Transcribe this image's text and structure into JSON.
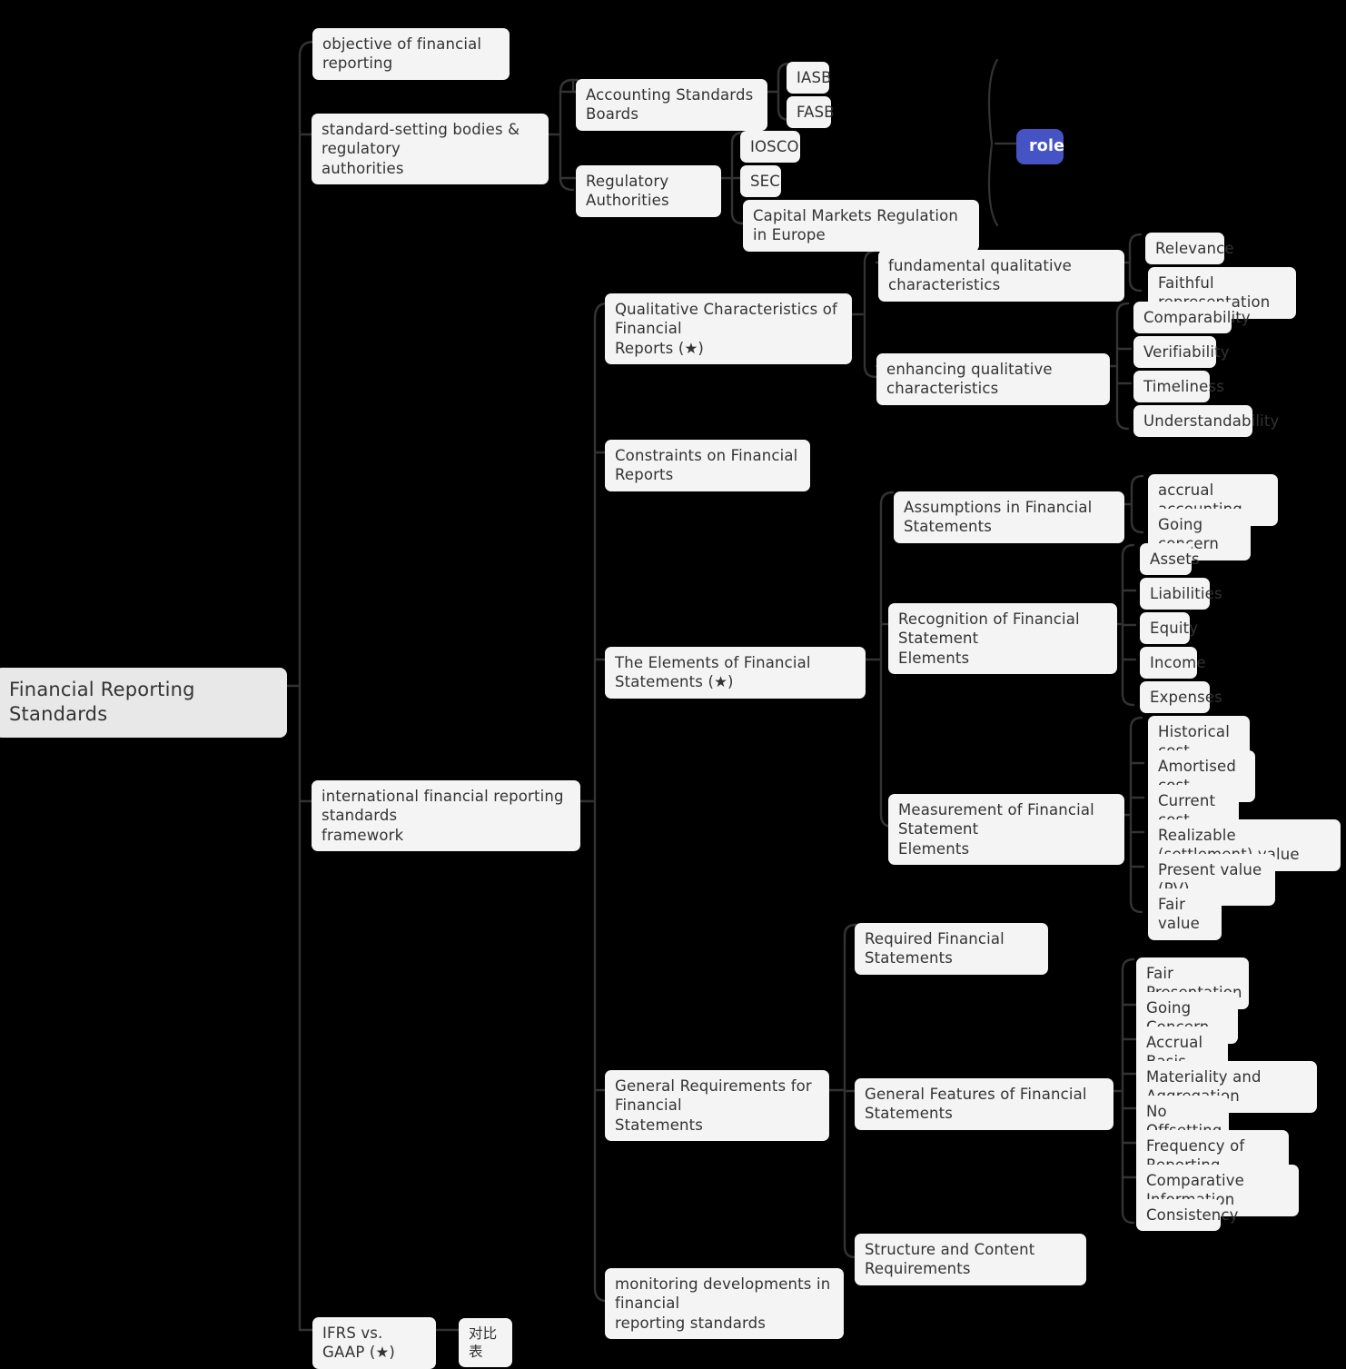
{
  "diagram": {
    "type": "mindmap",
    "title": "Financial Reporting Standards",
    "background_color": "#000000",
    "node_color": "#f4f4f4",
    "root_color": "#e8e8e8",
    "accent_color": "#4553c4",
    "text_color": "#333333",
    "edge_color": "#333333"
  },
  "nodes": {
    "root": "Financial Reporting Standards",
    "objective": "objective of financial reporting",
    "standard_setting": "standard-setting bodies & regulatory\nauthorities",
    "accounting_boards": "Accounting Standards Boards",
    "iasb": "IASB",
    "fasb": "FASB",
    "regulatory_authorities": "Regulatory Authorities",
    "iosco": "IOSCO",
    "sec": "SEC",
    "capital_markets_europe": "Capital Markets Regulation in Europe",
    "role": "role",
    "ifrs_framework": "international financial reporting standards\nframework",
    "qualitative_characteristics": "Qualitative Characteristics of Financial\nReports (★)",
    "fundamental_qc": "fundamental qualitative characteristics",
    "relevance": "Relevance",
    "faithful_representation": "Faithful representation",
    "enhancing_qc": "enhancing qualitative characteristics",
    "comparability": "Comparability",
    "verifiability": "Verifiability",
    "timeliness": "Timeliness",
    "understandability": "Understandability",
    "constraints": "Constraints on Financial Reports",
    "elements": "The Elements of Financial Statements (★)",
    "assumptions": "Assumptions in Financial Statements",
    "accrual_accounting": "accrual accounting",
    "going_concern_lower": "Going concern",
    "recognition": "Recognition of Financial Statement\nElements",
    "assets": "Assets",
    "liabilities": "Liabilities",
    "equity": "Equity",
    "income": "Income",
    "expenses": "Expenses",
    "measurement": "Measurement of Financial Statement\nElements",
    "historical_cost": "Historical cost",
    "amortised_cost": "Amortised cost",
    "current_cost": "Current cost",
    "realizable_value": "Realizable (settlement) value",
    "present_value": "Present value (PV)",
    "fair_value": "Fair value",
    "general_requirements": "General Requirements for Financial\nStatements",
    "required_statements": "Required Financial Statements",
    "general_features": "General Features of Financial Statements",
    "fair_presentation": "Fair Presentation",
    "going_concern_upper": "Going Concern",
    "accrual_basis": "Accrual Basis",
    "materiality": "Materiality and Aggregation",
    "no_offsetting": "No Offsetting",
    "frequency": "Frequency of Reporting",
    "comparative_information": "Comparative Information",
    "consistency": "Consistency",
    "structure_content": "Structure and Content Requirements",
    "monitoring": "monitoring developments in financial\nreporting standards",
    "ifrs_vs_gaap": "IFRS vs. GAAP (★)",
    "comparison_table": "对比表"
  }
}
